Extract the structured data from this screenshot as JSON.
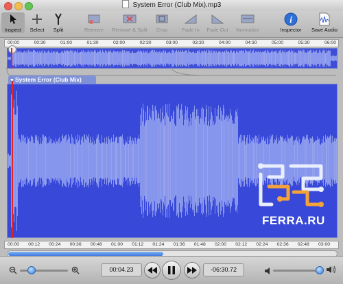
{
  "window": {
    "title": "System Error (Club Mix).mp3"
  },
  "toolbar": {
    "inspect": "Inspect",
    "select": "Select",
    "split": "Split",
    "remove": "Remove",
    "remove_split": "Remove & Split",
    "crop": "Crop",
    "fade_in": "Fade In",
    "fade_out": "Fade Out",
    "normalize": "Normalize",
    "inspector": "Inspector",
    "save_audio": "Save Audio"
  },
  "top_ruler": [
    "00:00",
    "00:30",
    "01:00",
    "01:30",
    "02:00",
    "02:30",
    "03:00",
    "03:30",
    "04:00",
    "04:30",
    "05:00",
    "05:30",
    "06:00"
  ],
  "track": {
    "name": "System Error (Club Mix)"
  },
  "bottom_ruler": [
    "00:00",
    "00:12",
    "00:24",
    "00:36",
    "00:48",
    "01:00",
    "01:12",
    "01:24",
    "01:36",
    "01:48",
    "02:00",
    "02:12",
    "02:24",
    "02:36",
    "02:48",
    "03:00"
  ],
  "transport": {
    "current_time": "00:04.23",
    "remaining_time": "-06:30.72"
  },
  "watermark": {
    "text": "FERRA.RU"
  },
  "colors": {
    "waveform_bg": "#3848d8",
    "waveform": "#c8d6ff",
    "playhead": "#e02424"
  }
}
